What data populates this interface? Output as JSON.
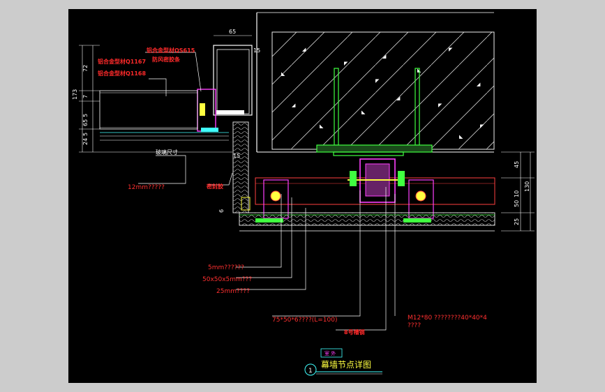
{
  "drawing": {
    "tag": "室 外",
    "number": "1",
    "title": "幕墙节点详图"
  },
  "labels": {
    "al_profile_1": "铝合金型材QS615",
    "al_sealant": "防风密胶条",
    "al_profile_2": "铝合金型材Q1167",
    "al_profile_3": "铝合金型材Q1168",
    "glass_size": "玻璃尺寸",
    "glass_12mm": "12mm?????",
    "seal_strip": "密封胶",
    "l_5mm": "5mm??????",
    "l_50x50": "50x50x5mm???",
    "l_25mm": "25mm????",
    "l_75x50": "75*50*6????(L=100)",
    "l_8steel": "8号槽钢",
    "l_m12_a": "M12*80  ????????40*40*4",
    "l_m12_b": "????"
  },
  "dimensions": {
    "left": [
      "72",
      "173",
      "7",
      "5",
      "65",
      "24",
      "5"
    ],
    "right": [
      "45",
      "130",
      "10",
      "50",
      "25"
    ],
    "top": "65",
    "misc": [
      "15",
      "6",
      "15"
    ]
  },
  "colors": {
    "background": "#000000",
    "frame": "#cccccc",
    "red": "#ff3030",
    "magenta": "#ff40ff",
    "green": "#40ff40",
    "white": "#ffffff",
    "yellow": "#ffff40",
    "cyan": "#40ffff"
  }
}
